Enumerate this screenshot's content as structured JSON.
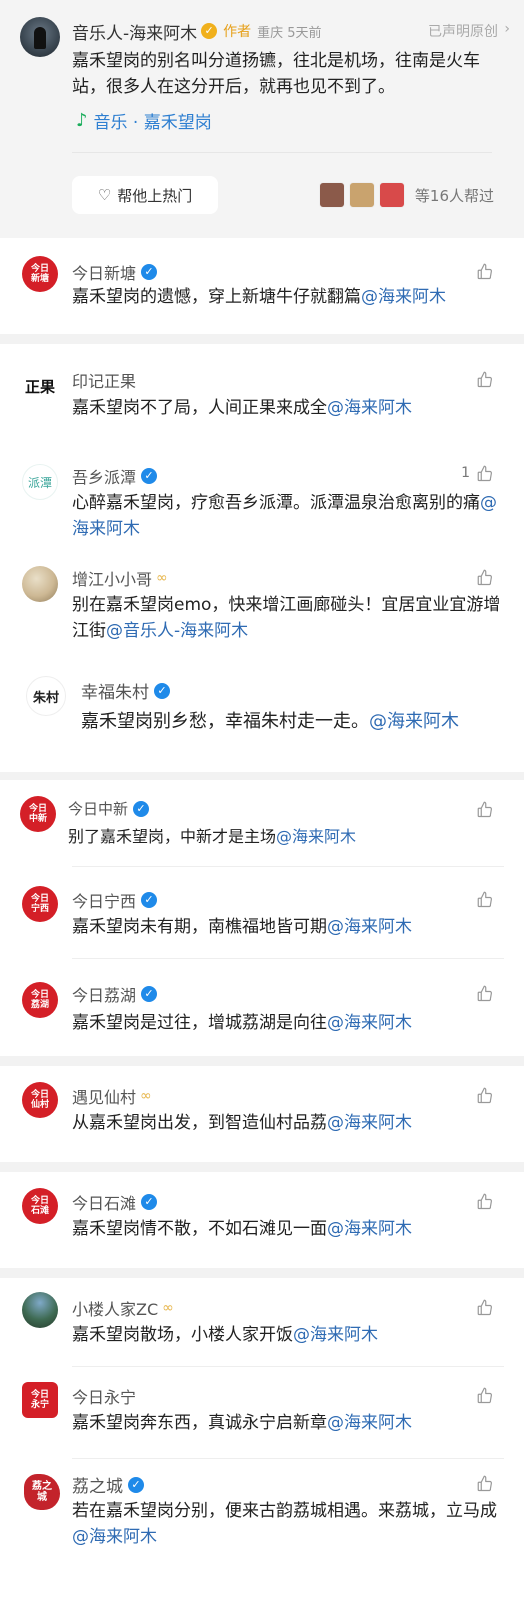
{
  "post": {
    "author": "音乐人-海来阿木",
    "role": "作者",
    "meta": "重庆 5天前",
    "original": "已声明原创",
    "text": "嘉禾望岗的别名叫分道扬镳，往北是机场，往南是火车站，很多人在这分开后，就再也见不到了。",
    "music": "音乐 · 嘉禾望岗",
    "boost_button": "帮他上热门",
    "helpers_text": "等16人帮过"
  },
  "comments": [
    {
      "name": "今日新塘",
      "avatar": "今日\n新塘",
      "verified": true,
      "body": "嘉禾望岗的遗憾，穿上新塘牛仔就翻篇",
      "mention": "@海来阿木",
      "likes": ""
    },
    {
      "name": "印记正果",
      "avatar": "正果",
      "verified": false,
      "body": "嘉禾望岗不了局，人间正果来成全",
      "mention": "@海来阿木",
      "likes": ""
    },
    {
      "name": "吾乡派潭",
      "avatar": "派潭",
      "verified": true,
      "body": "心醉嘉禾望岗，疗愈吾乡派潭。派潭温泉治愈离别的痛",
      "mention": "@海来阿木",
      "likes": "1"
    },
    {
      "name": "增江小小哥",
      "avatar": "",
      "verified": false,
      "body": "别在嘉禾望岗emo，快来增江画廊碰头！宜居宜业宜游增江街",
      "mention": "@音乐人-海来阿木",
      "likes": ""
    },
    {
      "name": "幸福朱村",
      "avatar": "朱村",
      "verified": true,
      "body": "嘉禾望岗别乡愁，幸福朱村走一走。",
      "mention": "@海来阿木",
      "likes": ""
    },
    {
      "name": "今日中新",
      "avatar": "今日\n中新",
      "verified": true,
      "body": "别了嘉禾望岗，中新才是主场",
      "mention": "@海来阿木",
      "likes": ""
    },
    {
      "name": "今日宁西",
      "avatar": "今日\n宁西",
      "verified": true,
      "body": "嘉禾望岗未有期，南樵福地皆可期",
      "mention": "@海来阿木",
      "likes": ""
    },
    {
      "name": "今日荔湖",
      "avatar": "今日\n荔湖",
      "verified": true,
      "body": "嘉禾望岗是过往，增城荔湖是向往",
      "mention": "@海来阿木",
      "likes": ""
    },
    {
      "name": "遇见仙村",
      "avatar": "今日\n仙村",
      "verified": false,
      "body": "从嘉禾望岗出发，到智造仙村品荔",
      "mention": "@海来阿木",
      "likes": ""
    },
    {
      "name": "今日石滩",
      "avatar": "今日\n石滩",
      "verified": true,
      "body": "嘉禾望岗情不散，不如石滩见一面",
      "mention": "@海来阿木",
      "likes": ""
    },
    {
      "name": "小楼人家ZC",
      "avatar": "",
      "verified": false,
      "body": "嘉禾望岗散场，小楼人家开饭",
      "mention": "@海来阿木",
      "likes": ""
    },
    {
      "name": "今日永宁",
      "avatar": "今日\n永宁",
      "verified": false,
      "body": "嘉禾望岗奔东西，真诚永宁启新章",
      "mention": "@海来阿木",
      "likes": ""
    },
    {
      "name": "荔之城",
      "avatar": "荔之\n城",
      "verified": true,
      "body": "若在嘉禾望岗分别，便来古韵荔城相遇。来荔城，立马成",
      "mention": "@海来阿木",
      "likes": ""
    }
  ]
}
